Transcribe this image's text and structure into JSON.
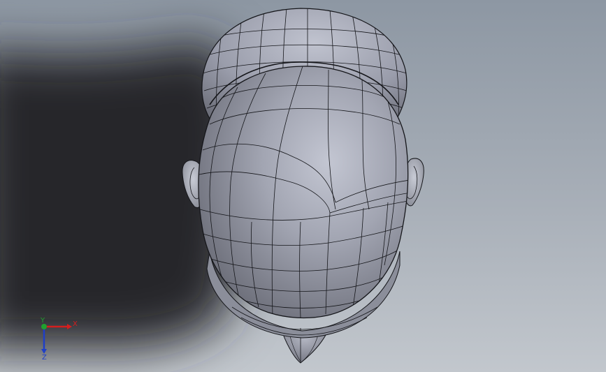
{
  "viewport": {
    "background_top": "#8d97a3",
    "background_bottom": "#c2c7cd",
    "shadow_color": "#25282c",
    "model_color": "#9ea1ad",
    "wire_color": "#15161a"
  },
  "triad": {
    "x_label": "X",
    "y_label": "Y",
    "z_label": "Z",
    "x_color": "#d41e1e",
    "y_color": "#1fa12f",
    "z_color": "#1f3fc7"
  }
}
